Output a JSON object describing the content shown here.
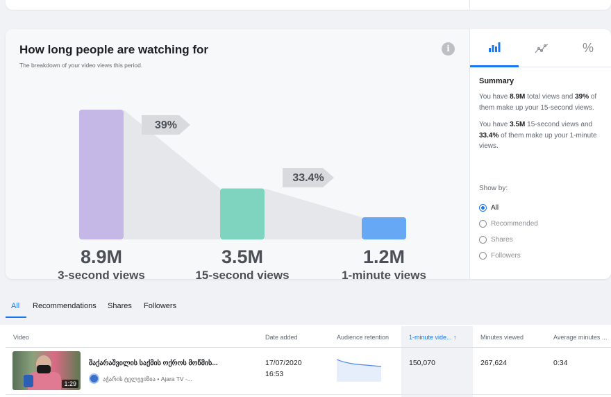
{
  "header": {
    "title": "How long people are watching for",
    "subtitle": "The breakdown of your video views this period.",
    "info_icon": "info-icon"
  },
  "funnel": {
    "bars": [
      {
        "value_label": "8.9M",
        "label": "3-second views",
        "value": 8.9,
        "color": "#c5b8e6"
      },
      {
        "value_label": "3.5M",
        "label": "15-second views",
        "value": 3.5,
        "color": "#7fd4c0"
      },
      {
        "value_label": "1.2M",
        "label": "1-minute views",
        "value": 1.2,
        "color": "#67a8f5"
      }
    ],
    "conversions": [
      "39%",
      "33.4%"
    ],
    "connector_color": "#e6e7ea",
    "arrow_color": "#d9dadd"
  },
  "side_panel": {
    "tabs": [
      {
        "icon": "bar-chart-icon",
        "active": true
      },
      {
        "icon": "line-chart-icon",
        "active": false
      },
      {
        "icon": "percent-icon",
        "active": false
      }
    ],
    "summary_title": "Summary",
    "summary_1": {
      "a": "You have ",
      "b": "8.9M",
      "c": " total views and ",
      "d": "39%",
      "e": " of them make up your 15-second views."
    },
    "summary_2": {
      "a": "You have ",
      "b": "3.5M",
      "c": " 15-second views and ",
      "d": "33.4%",
      "e": " of them make up your 1-minute views."
    },
    "show_by_label": "Show by:",
    "show_by_options": [
      {
        "label": "All",
        "selected": true
      },
      {
        "label": "Recommended",
        "selected": false
      },
      {
        "label": "Shares",
        "selected": false
      },
      {
        "label": "Followers",
        "selected": false
      }
    ]
  },
  "filter_tabs": [
    "All",
    "Recommendations",
    "Shares",
    "Followers"
  ],
  "table": {
    "columns": [
      "Video",
      "Date added",
      "Audience retention",
      "1-minute vide...  ↑",
      "Minutes viewed",
      "Average minutes ..."
    ],
    "rows": [
      {
        "title": "შაქარაშვილის საქმის ოქროს მოწმის...",
        "page": "აჭარის ტელევიზია • Ajara TV -...",
        "duration": "1:29",
        "date": "17/07/2020",
        "time": "16:53",
        "one_minute_views": "150,070",
        "minutes_viewed": "267,624",
        "average_minutes": "0:34"
      }
    ]
  },
  "colors": {
    "accent": "#1877f2"
  }
}
